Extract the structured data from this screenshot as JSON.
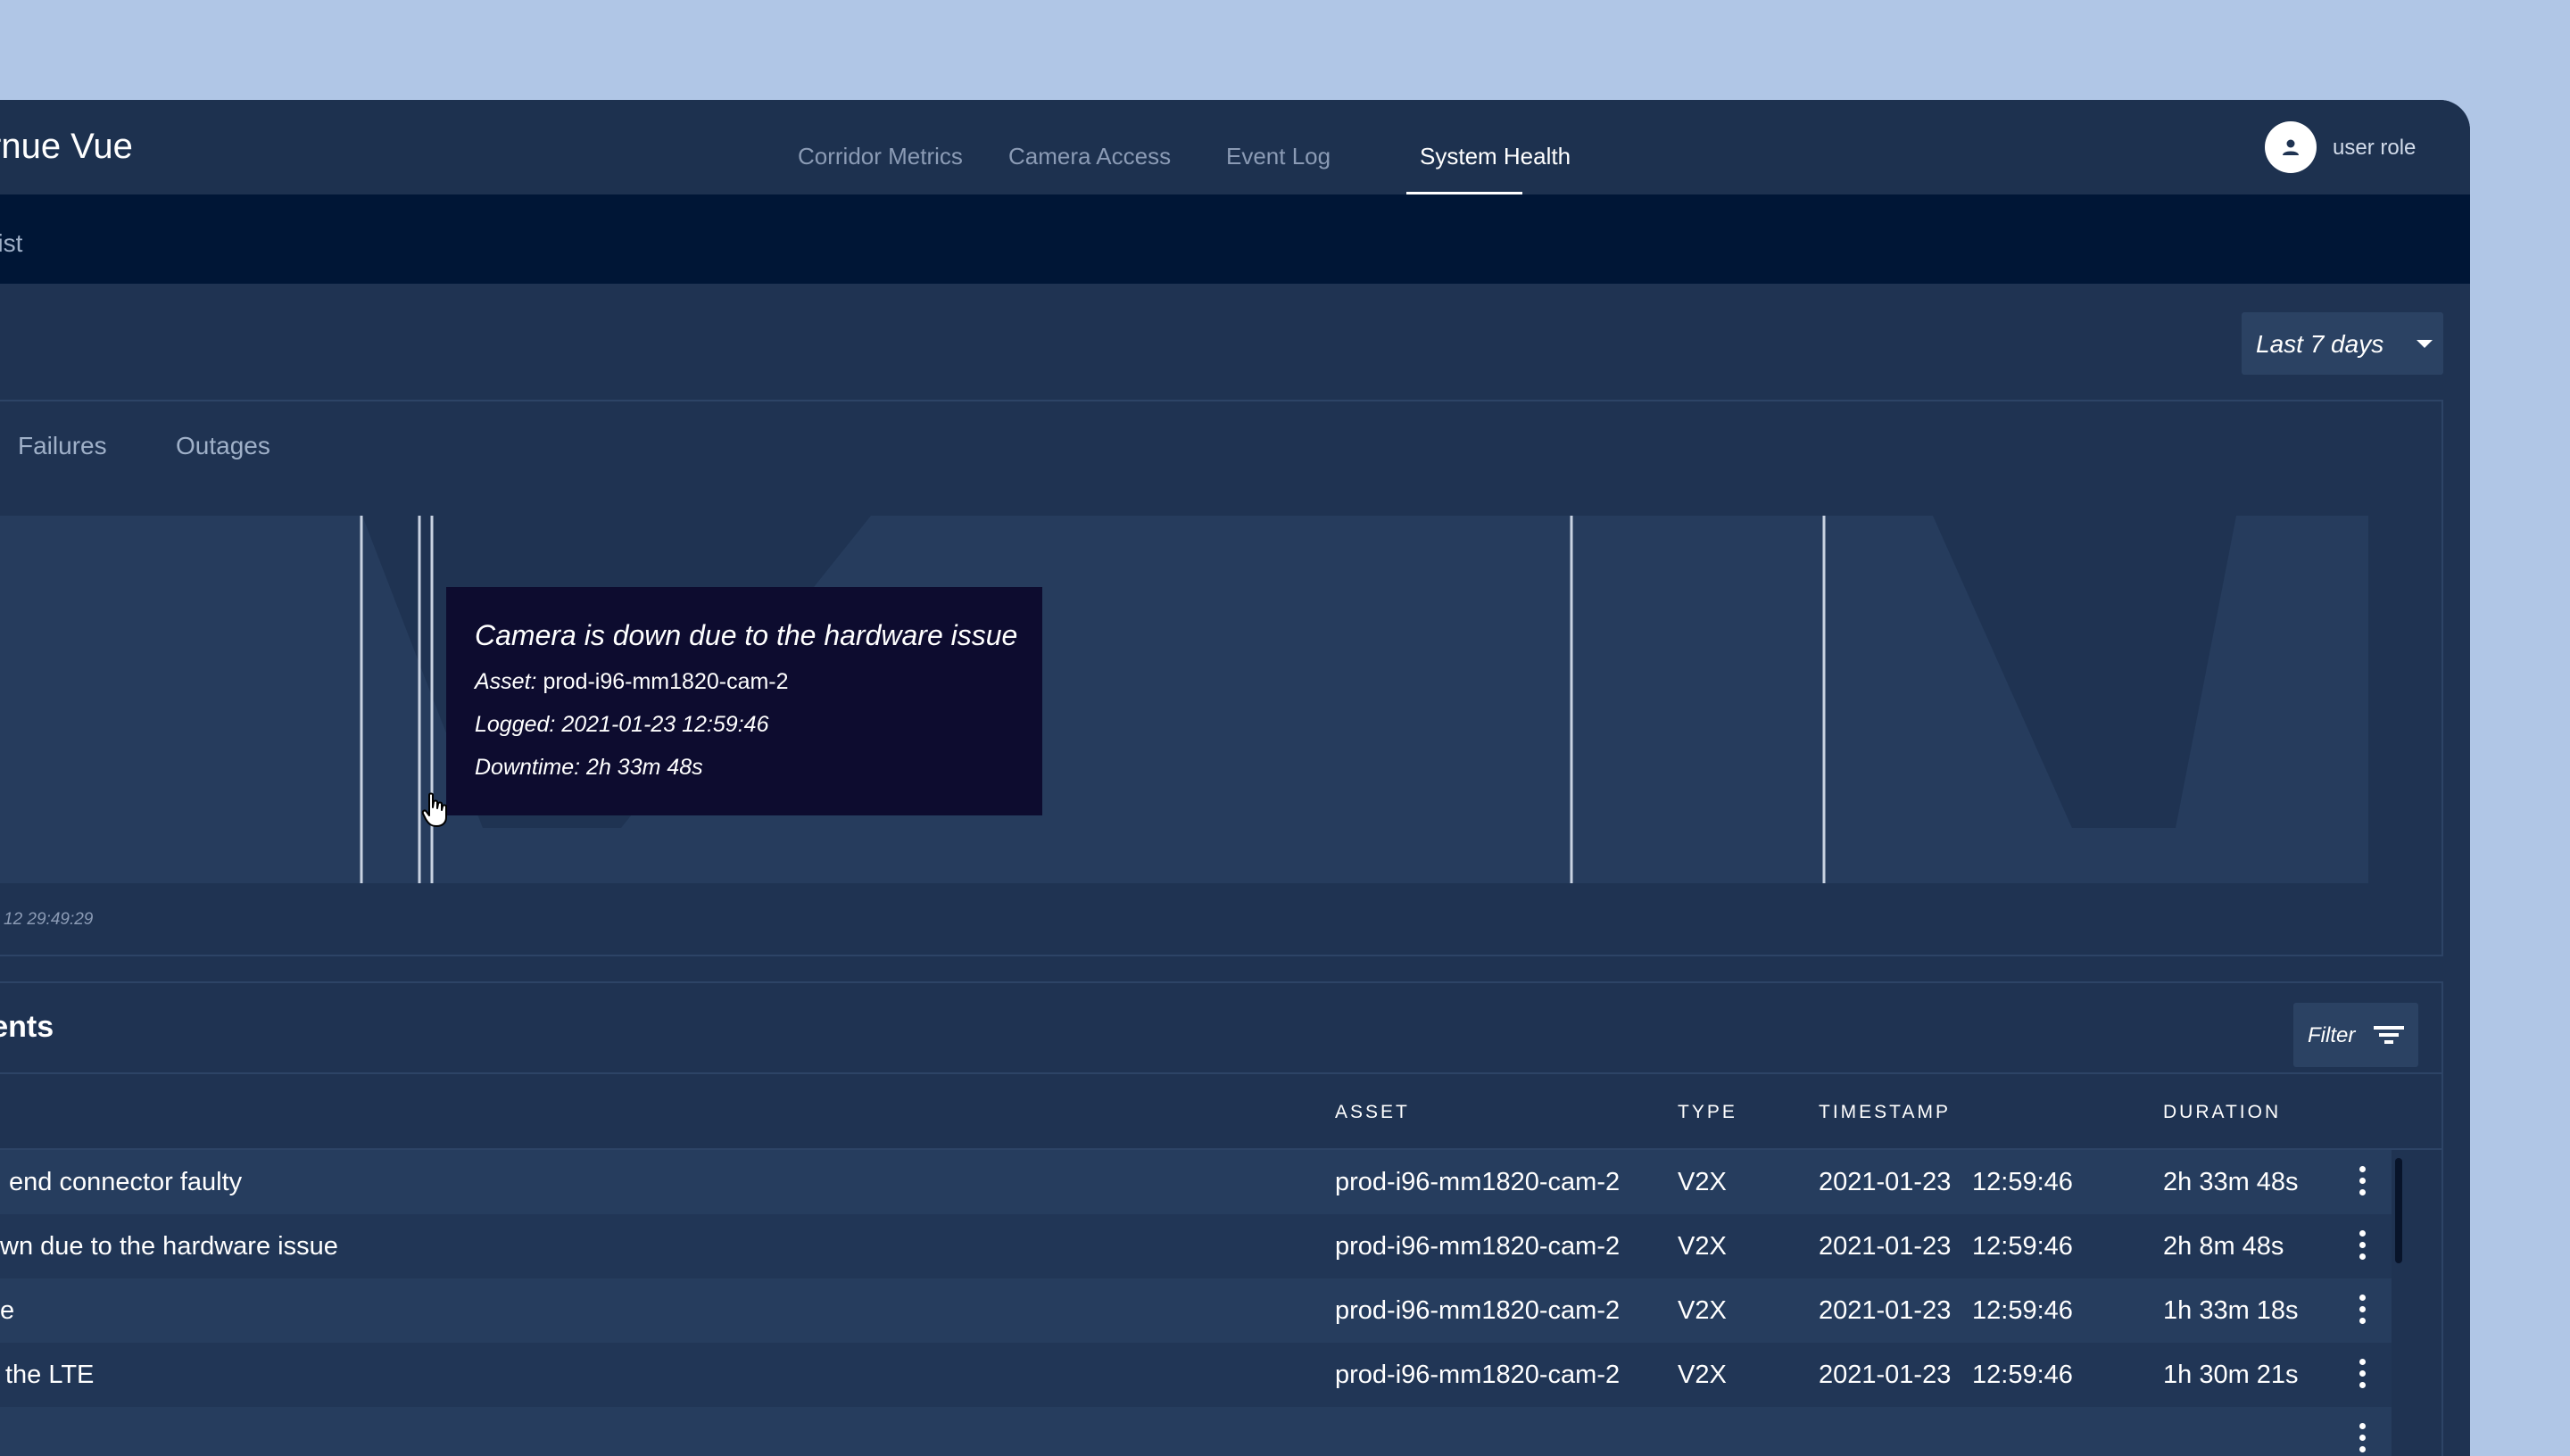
{
  "app": {
    "title": "rnue Vue"
  },
  "nav": {
    "items": [
      {
        "label": "Corridor Metrics"
      },
      {
        "label": "Camera Access"
      },
      {
        "label": "Event Log"
      },
      {
        "label": "System Health"
      }
    ],
    "active": "System Health"
  },
  "user": {
    "role": "user role",
    "avatar_icon": "person-icon"
  },
  "breadcrumb": {
    "label": "et list"
  },
  "range": {
    "selected": "Last 7 days",
    "icon": "caret-down-icon"
  },
  "chart": {
    "tabs": [
      "Failures",
      "Outages"
    ],
    "time_label": "12 29:49:29",
    "tooltip": {
      "title": "Camera is down due to the hardware issue",
      "asset_key": "Asset:",
      "asset_value": "prod-i96-mm1820-cam-2",
      "logged_key": "Logged:",
      "logged_value": "2021-01-23 12:59:46",
      "downtime_key": "Downtime:",
      "downtime_value": "2h 33m 48s"
    },
    "colors": {
      "area": "#2b4465",
      "background": "#263c5d",
      "marker": "#c9d3e2"
    }
  },
  "incidents": {
    "title": "idents",
    "filter_label": "Filter",
    "filter_icon": "filter-icon",
    "columns": [
      "ASSET",
      "TYPE",
      "TIMESTAMP",
      "DURATION"
    ],
    "rows": [
      {
        "desc": "end connector faulty",
        "asset": "prod-i96-mm1820-cam-2",
        "type": "V2X",
        "date": "2021-01-23",
        "time": "12:59:46",
        "duration": "2h 33m 48s"
      },
      {
        "desc": "wn due to the hardware issue",
        "asset": "prod-i96-mm1820-cam-2",
        "type": "V2X",
        "date": "2021-01-23",
        "time": "12:59:46",
        "duration": "2h 8m 48s"
      },
      {
        "desc": "e",
        "asset": "prod-i96-mm1820-cam-2",
        "type": "V2X",
        "date": "2021-01-23",
        "time": "12:59:46",
        "duration": "1h 33m 18s"
      },
      {
        "desc": "the LTE",
        "asset": "prod-i96-mm1820-cam-2",
        "type": "V2X",
        "date": "2021-01-23",
        "time": "12:59:46",
        "duration": "1h 30m 21s"
      }
    ]
  }
}
